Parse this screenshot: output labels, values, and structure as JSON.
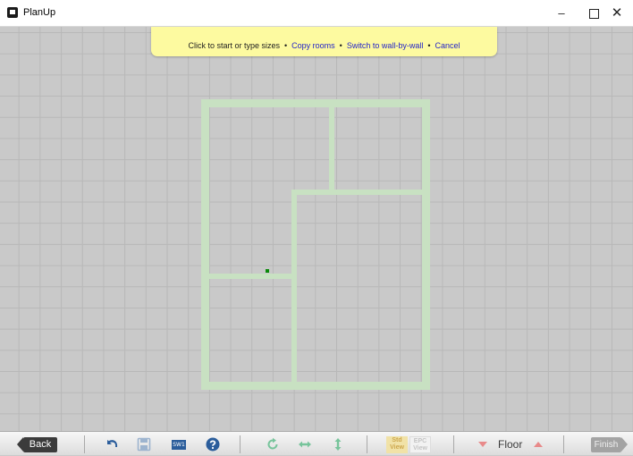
{
  "window": {
    "title": "PlanUp",
    "minimize_glyph": "–",
    "close_glyph": "✕"
  },
  "hint_bar": {
    "text": "Click to start or type sizes",
    "separator": "•",
    "links": [
      "Copy rooms",
      "Switch to wall-by-wall",
      "Cancel"
    ]
  },
  "toolbar": {
    "back_label": "Back",
    "sw1_label": "SW1",
    "std_view": [
      "Std",
      "View"
    ],
    "epc_view": [
      "EPC",
      "View"
    ],
    "floor_label": "Floor",
    "finish_label": "Finish",
    "icons": [
      "undo-icon",
      "save-icon",
      "help-icon",
      "rotate-icon",
      "flip-horizontal-icon",
      "flip-vertical-icon",
      "floor-down-icon",
      "floor-up-icon"
    ]
  },
  "colors": {
    "wall": "#c8e1c2",
    "cursor": "#0a8a0a",
    "accent_blue": "#2b5d9b",
    "hint_bg": "#fdfaa0",
    "link": "#2323c8",
    "floor_arrow": "#e88a8a",
    "icon_green": "#77c49b"
  }
}
